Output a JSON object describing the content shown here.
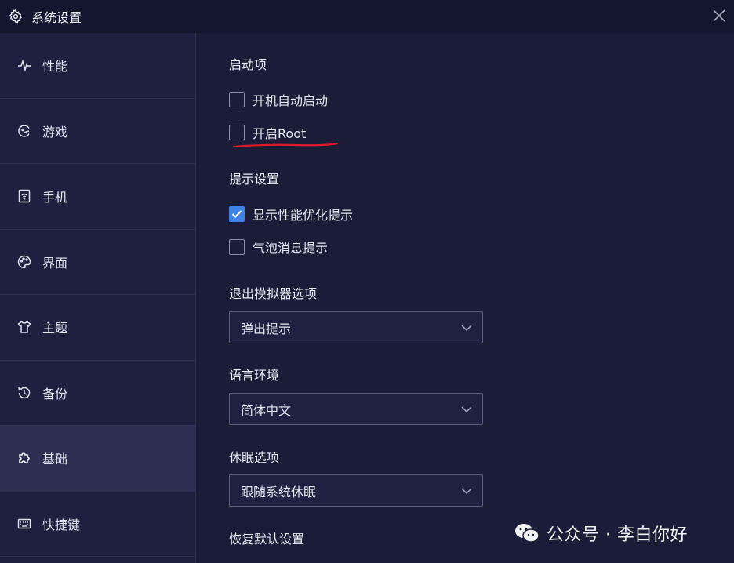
{
  "window": {
    "title": "系统设置"
  },
  "sidebar": {
    "items": [
      {
        "label": "性能",
        "icon": "pulse-icon"
      },
      {
        "label": "游戏",
        "icon": "gamepad-icon"
      },
      {
        "label": "手机",
        "icon": "phone-wifi-icon"
      },
      {
        "label": "界面",
        "icon": "palette-icon"
      },
      {
        "label": "主题",
        "icon": "tshirt-icon"
      },
      {
        "label": "备份",
        "icon": "history-icon"
      },
      {
        "label": "基础",
        "icon": "puzzle-icon",
        "active": true
      },
      {
        "label": "快捷键",
        "icon": "keyboard-icon"
      }
    ]
  },
  "main": {
    "startup": {
      "title": "启动项",
      "autostart": {
        "label": "开机自动启动",
        "checked": false
      },
      "root": {
        "label": "开启Root",
        "checked": false
      }
    },
    "tips": {
      "title": "提示设置",
      "perf_tip": {
        "label": "显示性能优化提示",
        "checked": true
      },
      "bubble_tip": {
        "label": "气泡消息提示",
        "checked": false
      }
    },
    "exit": {
      "title": "退出模拟器选项",
      "value": "弹出提示"
    },
    "language": {
      "title": "语言环境",
      "value": "简体中文"
    },
    "sleep": {
      "title": "休眠选项",
      "value": "跟随系统休眠"
    },
    "reset": {
      "title": "恢复默认设置"
    }
  },
  "watermark": {
    "text": "公众号 · 李白你好"
  },
  "colors": {
    "accent": "#3f83e6",
    "annotation": "#e0182c",
    "background": "#1b1d38"
  }
}
